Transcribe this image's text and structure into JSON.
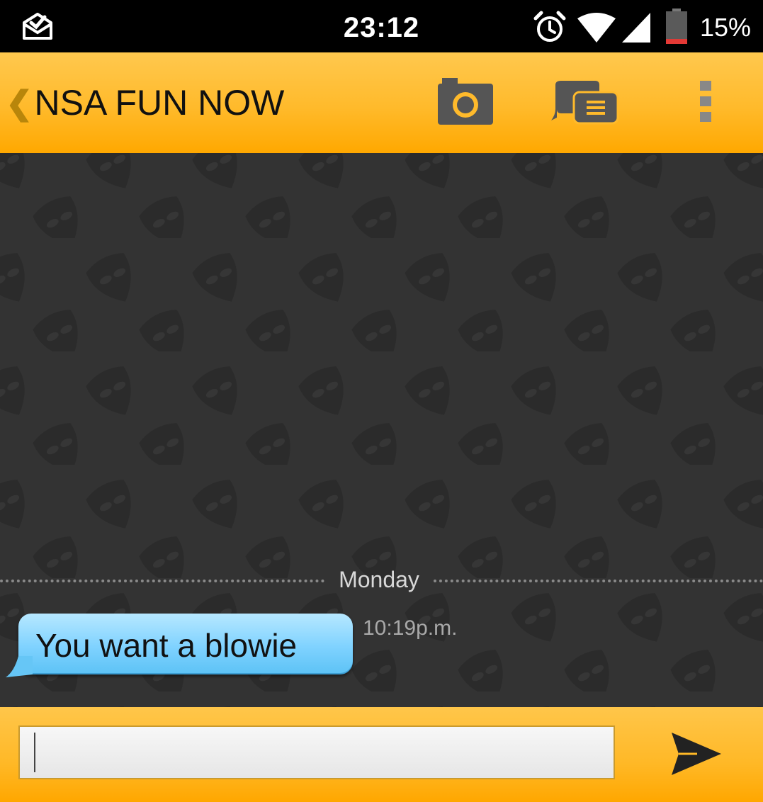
{
  "status_bar": {
    "time": "23:12",
    "battery_percent": "15%",
    "battery_level": 0.15,
    "icons": [
      "notification-check-icon",
      "alarm-icon",
      "wifi-icon",
      "cell-signal-icon",
      "battery-icon"
    ]
  },
  "action_bar": {
    "back_chevron": "❮",
    "title": "NSA FUN NOW",
    "actions": [
      "camera-icon",
      "saved-phrases-icon",
      "overflow-menu-icon"
    ]
  },
  "chat": {
    "date_divider": "Monday",
    "messages": [
      {
        "text": "You want a blowie",
        "time": "10:19p.m.",
        "direction": "incoming"
      }
    ]
  },
  "composer": {
    "value": "",
    "placeholder": "",
    "send_icon": "send-icon"
  },
  "colors": {
    "accent": "#FFB826",
    "bubble": "#7FD2FF",
    "chat_background": "#333333",
    "battery_low": "#E53935"
  }
}
